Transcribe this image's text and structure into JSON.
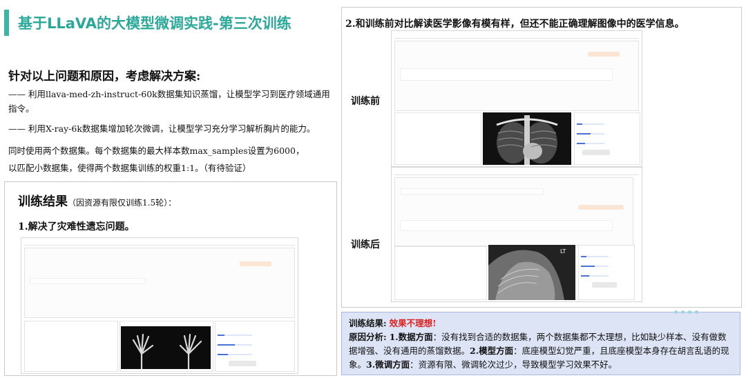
{
  "title": "基于LLaVA的大模型微调实践-第三次训练",
  "heading": "针对以上问题和原因，考虑解决方案:",
  "solutions": [
    "—— 利用llava-med-zh-instruct-60k数据集知识蒸馏，让模型学习到医疗领域通用指令。",
    "—— 利用X-ray-6k数据集增加轮次微调，让模型学习充分学习解析胸片的能力。"
  ],
  "note_line1": "同时使用两个数据集。每个数据集的最大样本数max_samples设置为6000，",
  "note_line2": "以匹配小数据集，使得两个数据集训练的权重1:1。（有待验证）",
  "result_title": "训练结果",
  "result_title_note": "（因资源有限仅训练1.5轮）：",
  "result_item1": "1.解决了灾难性遗忘问题。",
  "right_heading": "2.和训练前对比解读医学影像有模有样，但还不能正确理解图像中的医学信息。",
  "label_before": "训练前",
  "label_after": "训练后",
  "summary": {
    "label": "训练结果:",
    "verdict": "效果不理想!",
    "cause_label": "原因分析:",
    "p1_label": "1.数据方面",
    "p1_text": "：没有找到合适的数据集，两个数据集都不太理想，比如缺少样本、没有做数据增强、没有通用的蒸馏数据。",
    "p2_label": "2.模型方面",
    "p2_text": "：底座模型幻觉严重，且底座模型本身存在胡言乱语的现象。",
    "p3_label": "3.微调方面",
    "p3_text": "：资源有限、微调轮次过少，导致模型学习效果不好。"
  },
  "colors": {
    "accent": "#3bb6a2",
    "verdict": "#e02020",
    "summary_bg": "#dce4f5"
  }
}
